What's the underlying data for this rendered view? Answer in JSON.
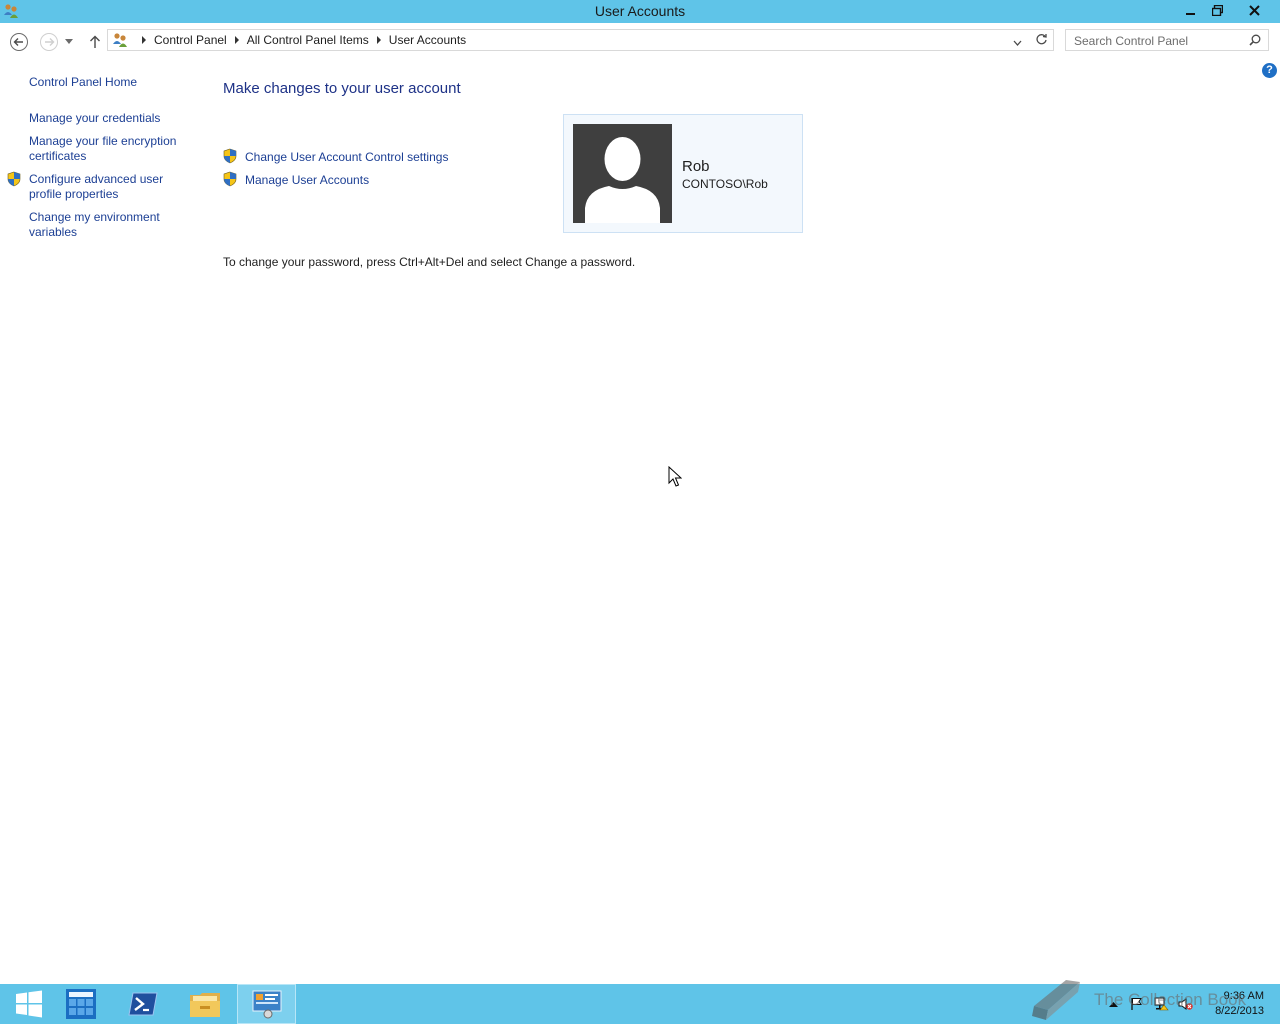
{
  "window": {
    "title": "User Accounts"
  },
  "address": {
    "breadcrumbs": [
      "Control Panel",
      "All Control Panel Items",
      "User Accounts"
    ]
  },
  "search": {
    "placeholder": "Search Control Panel"
  },
  "left_nav": {
    "home": "Control Panel Home",
    "credentials": "Manage your credentials",
    "encryption_line1": "Manage your file encryption",
    "encryption_line2": "certificates",
    "profile_line1": "Configure advanced user",
    "profile_line2": "profile properties",
    "env_line1": "Change my environment",
    "env_line2": "variables"
  },
  "main": {
    "heading": "Make changes to your user account",
    "tasks": [
      "Change User Account Control settings",
      "Manage User Accounts"
    ],
    "password_note": "To change your password, press Ctrl+Alt+Del and select Change a password."
  },
  "user": {
    "name": "Rob",
    "domain": "CONTOSO\\Rob"
  },
  "taskbar": {
    "time": "9:36 AM",
    "date": "8/22/2013"
  },
  "watermark": {
    "text": "The Collection Book"
  },
  "colors": {
    "title_bar": "#5fc4e8",
    "link": "#1c3f94",
    "heading": "#1e3287"
  },
  "icons": [
    "user-accounts-icon",
    "minimize-icon",
    "restore-icon",
    "close-icon",
    "back-arrow-icon",
    "forward-arrow-icon",
    "recent-dropdown-icon",
    "up-arrow-icon",
    "address-dropdown-icon",
    "refresh-icon",
    "search-icon",
    "help-icon",
    "uac-shield-icon",
    "default-user-avatar",
    "start-icon",
    "server-manager-icon",
    "powershell-icon",
    "file-explorer-icon",
    "control-panel-icon",
    "notification-chevron-icon",
    "flag-icon",
    "network-icon",
    "volume-muted-icon"
  ]
}
